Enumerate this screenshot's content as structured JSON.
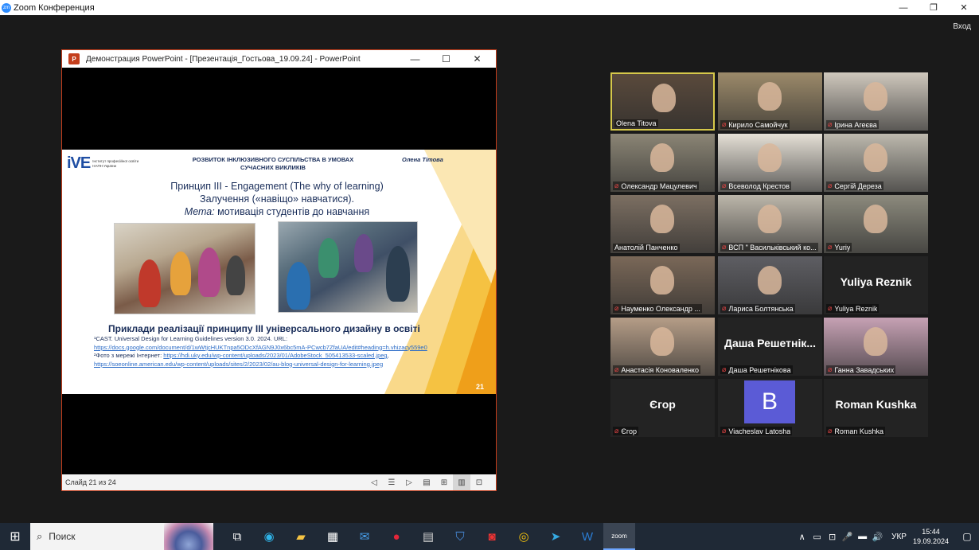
{
  "zoom": {
    "app_icon": "zm",
    "title": "Zoom Конференция",
    "enter_label": "Вход",
    "controls": [
      "—",
      "❐",
      "✕"
    ]
  },
  "ppt": {
    "title": "Демонстрация PowerPoint - [Презентація_Гостьова_19.09.24] - PowerPoint",
    "icon_label": "P",
    "controls": [
      "—",
      "☐",
      "✕"
    ],
    "status_slide": "Слайд 21 из 24",
    "status_icons": [
      "◁",
      "☰",
      "▷",
      "▤",
      "⊞",
      "▥",
      "⊡"
    ]
  },
  "slide": {
    "logo_mark": "iVE",
    "logo_text": "Інститут професійної освіти НАПН України",
    "header": "РОЗВИТОК ІНКЛЮЗИВНОГО СУСПІЛЬСТВА В УМОВАХ СУЧАСНИХ ВИКЛИКІВ",
    "author": "Олена Тітова",
    "title_line1": "Принцип ІІІ - Engagement (The why of learning)",
    "title_line2": "Залучення («навіщо» навчатися).",
    "title_line3_em": "Мета:",
    "title_line3": " мотивація студентів до навчання",
    "subtitle": "Приклади реалізації принципу ІІІ універсального дизайну в освіті",
    "ref1": "¹CAST. Universal Design for Learning Guidelines version 3.0. 2024. URL:",
    "ref1_link": "https://docs.google.com/document/d/1wWtjcHUKTnpa5ODcXfAGN9J0x6bc5mA-PCwcb7ZfaUA/edit#heading=h.vhizacy559e0",
    "ref2": "²Фото з мережі Інтернет: ",
    "ref2_link": "https://hdi.uky.edu/wp-content/uploads/2023/01/AdobeStock_505413533-scaled.jpeg",
    "ref2_sep": ", ",
    "ref2_link2": "https://soeonline.american.edu/wp-content/uploads/sites/2/2023/02/au-blog-universal-design-for-learning.jpeg",
    "number": "21"
  },
  "participants": [
    {
      "name": "Olena Titova",
      "muted": false,
      "video": true,
      "active": true
    },
    {
      "name": "Кирило Самойчук",
      "muted": true,
      "video": true
    },
    {
      "name": "Ірина Агеєва",
      "muted": true,
      "video": true
    },
    {
      "name": "Олександр Мацулевич",
      "muted": true,
      "video": true
    },
    {
      "name": "Всеволод Крестов",
      "muted": true,
      "video": true
    },
    {
      "name": "Сергій Дереза",
      "muted": true,
      "video": true
    },
    {
      "name": "Анатолій Панченко",
      "muted": false,
      "video": true
    },
    {
      "name": "ВСП \" Васильківський ко...",
      "muted": true,
      "video": true
    },
    {
      "name": "Yuriy",
      "muted": true,
      "video": true
    },
    {
      "name": "Науменко Олександр ...",
      "muted": true,
      "video": true
    },
    {
      "name": "Лариса Болтянська",
      "muted": true,
      "video": true
    },
    {
      "name": "Yuliya Reznik",
      "muted": true,
      "video": false,
      "display": "Yuliya Reznik"
    },
    {
      "name": "Анастасія Коноваленко",
      "muted": true,
      "video": true
    },
    {
      "name": "Даша Решетнікова",
      "muted": true,
      "video": false,
      "display": "Даша  Решетнік..."
    },
    {
      "name": "Ганна Завадських",
      "muted": true,
      "video": true
    },
    {
      "name": "Єгор",
      "muted": true,
      "video": false,
      "display": "Єгор"
    },
    {
      "name": "Viacheslav Latosha",
      "muted": true,
      "video": false,
      "avatar": "B"
    },
    {
      "name": "Roman Kushka",
      "muted": true,
      "video": false,
      "display": "Roman Kushka"
    }
  ],
  "taskbar": {
    "start_glyph": "⊞",
    "search_label": "Поиск",
    "apps": [
      {
        "name": "task-view",
        "glyph": "⧉",
        "color": "#ffffff"
      },
      {
        "name": "edge",
        "glyph": "◉",
        "color": "#2fb4e9"
      },
      {
        "name": "file-explorer",
        "glyph": "▰",
        "color": "#f5c343"
      },
      {
        "name": "store",
        "glyph": "▦",
        "color": "#ffffff"
      },
      {
        "name": "mail",
        "glyph": "✉",
        "color": "#4aa3f0"
      },
      {
        "name": "opera",
        "glyph": "●",
        "color": "#e3263a"
      },
      {
        "name": "calculator",
        "glyph": "▤",
        "color": "#d0d0d0"
      },
      {
        "name": "shield",
        "glyph": "⛉",
        "color": "#4a8fe0"
      },
      {
        "name": "recorder",
        "glyph": "◙",
        "color": "#e33"
      },
      {
        "name": "chrome",
        "glyph": "◎",
        "color": "#f4c20d"
      },
      {
        "name": "telegram",
        "glyph": "➤",
        "color": "#35a8e0"
      },
      {
        "name": "word",
        "glyph": "W",
        "color": "#2b7cd3"
      },
      {
        "name": "zoom",
        "glyph": "zoom",
        "color": "#ffffff"
      }
    ],
    "tray_icons": [
      "∧",
      "▭",
      "⊡",
      "🎤",
      "▬",
      "🔊"
    ],
    "language": "УКР",
    "time": "15:44",
    "date": "19.09.2024",
    "notification_glyph": "▢"
  }
}
